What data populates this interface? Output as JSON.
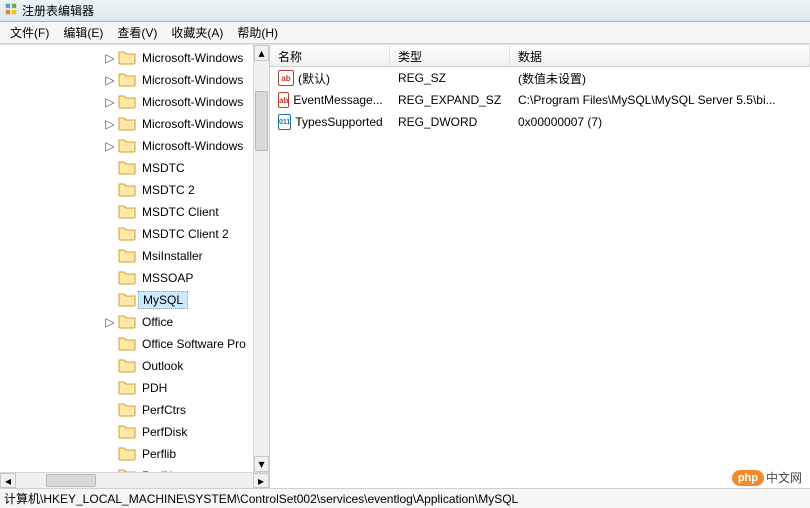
{
  "window": {
    "title": "注册表编辑器"
  },
  "menu": {
    "file": "文件(F)",
    "edit": "编辑(E)",
    "view": "查看(V)",
    "favorites": "收藏夹(A)",
    "help": "帮助(H)"
  },
  "tree": {
    "items": [
      {
        "label": "Microsoft-Windows",
        "expander": "▷"
      },
      {
        "label": "Microsoft-Windows",
        "expander": "▷"
      },
      {
        "label": "Microsoft-Windows",
        "expander": "▷"
      },
      {
        "label": "Microsoft-Windows",
        "expander": "▷"
      },
      {
        "label": "Microsoft-Windows",
        "expander": "▷"
      },
      {
        "label": "MSDTC",
        "expander": ""
      },
      {
        "label": "MSDTC 2",
        "expander": ""
      },
      {
        "label": "MSDTC Client",
        "expander": ""
      },
      {
        "label": "MSDTC Client 2",
        "expander": ""
      },
      {
        "label": "MsiInstaller",
        "expander": ""
      },
      {
        "label": "MSSOAP",
        "expander": ""
      },
      {
        "label": "MySQL",
        "expander": "",
        "selected": true
      },
      {
        "label": "Office",
        "expander": "▷"
      },
      {
        "label": "Office Software Pro",
        "expander": ""
      },
      {
        "label": "Outlook",
        "expander": ""
      },
      {
        "label": "PDH",
        "expander": ""
      },
      {
        "label": "PerfCtrs",
        "expander": ""
      },
      {
        "label": "PerfDisk",
        "expander": ""
      },
      {
        "label": "Perflib",
        "expander": ""
      },
      {
        "label": "PerfNet",
        "expander": ""
      }
    ]
  },
  "list": {
    "headers": {
      "name": "名称",
      "type": "类型",
      "data": "数据"
    },
    "rows": [
      {
        "name": "(默认)",
        "type": "REG_SZ",
        "data": "(数值未设置)",
        "icon": "str"
      },
      {
        "name": "EventMessage...",
        "type": "REG_EXPAND_SZ",
        "data": "C:\\Program Files\\MySQL\\MySQL Server 5.5\\bi...",
        "icon": "str"
      },
      {
        "name": "TypesSupported",
        "type": "REG_DWORD",
        "data": "0x00000007 (7)",
        "icon": "dword"
      }
    ]
  },
  "statusbar": {
    "path": "计算机\\HKEY_LOCAL_MACHINE\\SYSTEM\\ControlSet002\\services\\eventlog\\Application\\MySQL"
  },
  "watermark": {
    "bubble": "php",
    "text": "中文网"
  },
  "icons": {
    "str_glyph": "ab",
    "dword_glyph": "011"
  }
}
